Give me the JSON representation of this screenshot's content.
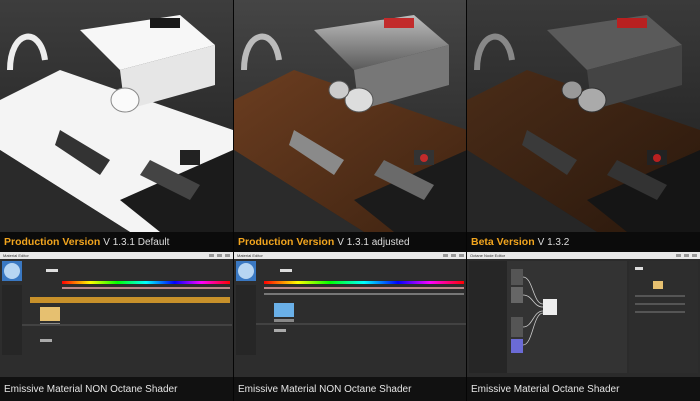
{
  "panels": [
    {
      "caption_highlight": "Production Version",
      "caption_rest": "V 1.3.1 Default",
      "footer": "Emissive Material NON Octane Shader",
      "editor_title": "Material Editor"
    },
    {
      "caption_highlight": "Production Version",
      "caption_rest": "V 1.3.1 adjusted",
      "footer": "Emissive Material NON Octane Shader",
      "editor_title": "Material Editor"
    },
    {
      "caption_highlight": "Beta Version",
      "caption_rest": "V 1.3.2",
      "footer": "Emissive Material Octane Shader",
      "editor_title": "Octane Node Editor"
    }
  ],
  "colors": {
    "highlight": "#f2a51e",
    "caption_text": "#dcdcdc",
    "editor_bg": "#2d2d2d",
    "accent_bar": "#c7902a"
  },
  "icons": [
    "close-icon",
    "minimize-icon",
    "maximize-icon"
  ]
}
